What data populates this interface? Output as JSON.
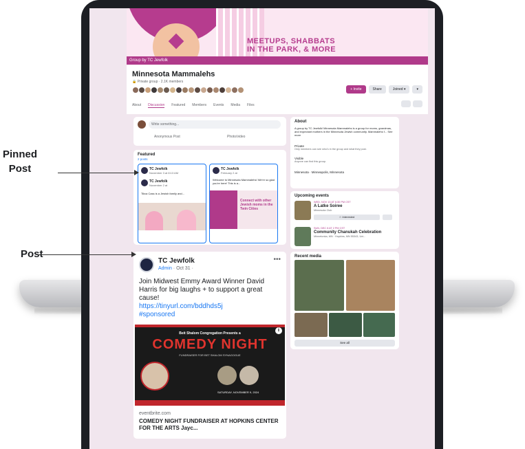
{
  "banner": {
    "headline": "MEETUPS, SHABBATS\nIN THE PARK, & MORE"
  },
  "group": {
    "bar_label": "Group by TC Jewfolk",
    "name": "Minnesota Mammalehs",
    "meta": "🔒 Private group · 2.1K members",
    "buttons": {
      "invite": "+ Invite",
      "share": "Share",
      "joined": "Joined ▾",
      "more": "▾"
    }
  },
  "tabs": [
    "About",
    "Discussion",
    "Featured",
    "Members",
    "Events",
    "Media",
    "Files"
  ],
  "composer": {
    "placeholder": "Write something...",
    "anon": "Anonymous Post",
    "photo": "Photo/video"
  },
  "featured": {
    "title": "Featured",
    "subtitle": "2 posts",
    "post1": {
      "author": "TC Jewfolk",
      "date": "November 3 at 8:13 AM",
      "inner_author": "TC Jewfolk",
      "inner_date": "November 2 at",
      "text": "Tikva Cass is a Jewish family and..."
    },
    "post2": {
      "author": "TC Jewfolk",
      "date": "February 2 at",
      "text": "Welcome to Minnesota Mammalehs! We're so glad you're here! This is a...",
      "promo": "Connect with other Jewish moms in the Twin Cities"
    }
  },
  "feed": {
    "author": "TC Jewfolk",
    "role": "Admin",
    "date": "· Oct 31 ·",
    "text": "Join Midwest Emmy Award Winner David Harris for big laughs + to support a great cause!",
    "url": "https://tinyurl.com/bddhds5j",
    "hashtag": "#sponsored",
    "poster": {
      "pre": "Beit Shalom Congregation Presents a",
      "title": "COMEDY NIGHT",
      "fund": "FUNDRAISER FOR BET SHALOM SYNAGOGUE",
      "date": "SATURDAY, NOVEMBER 9, 2024",
      "info": "i"
    },
    "domain": "eventbrite.com",
    "link_title": "COMEDY NIGHT FUNDRAISER AT HOPKINS CENTER FOR THE ARTS Jayc..."
  },
  "about": {
    "title": "About",
    "desc": "A group by TC Jewfolk! Minnesota Mammalehs is a group for moms, grandmas, and expectant mothers in the Minnesota Jewish community. Mammalehs f... See more",
    "private": "Private",
    "private_sub": "Only members can see who's in the group and what they post.",
    "visible": "Visible",
    "visible_sub": "Anyone can find this group.",
    "location": "Minnesota · Minneapolis, Minnesota"
  },
  "events": {
    "title": "Upcoming events",
    "e1": {
      "date": "WED, NOV 13 AT 6:30 PM CST",
      "name": "A Latke Soiree",
      "loc": "Minnesota Club",
      "btn": "☆ Interested"
    },
    "e2": {
      "date": "SUN, DEC 8 AT 2 PM CST",
      "name": "Community Chanukah Celebration",
      "loc": "Minnetonka, MN · Hopkins, MN 55343, Uni..."
    }
  },
  "media": {
    "title": "Recent media",
    "see_all": "See all"
  },
  "callouts": {
    "pinned": "Pinned\nPost",
    "post": "Post"
  },
  "colors": {
    "brand": "#b03a8a",
    "link": "#1877f2",
    "poster_red": "#e0342e"
  }
}
